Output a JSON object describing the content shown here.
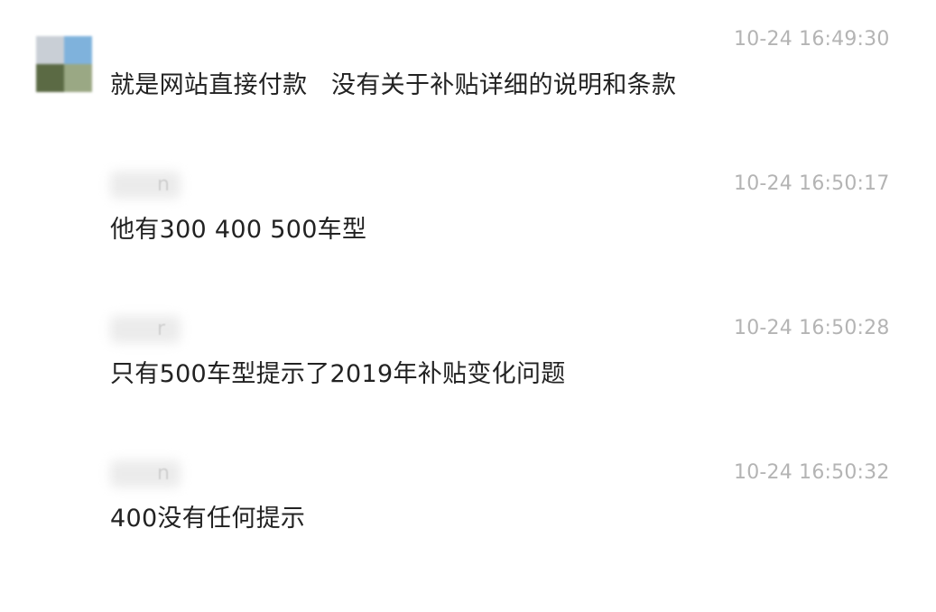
{
  "messages": [
    {
      "timestamp": "10-24 16:49:30",
      "text": "就是网站直接付款   没有关于补贴详细的说明和条款",
      "has_avatar": true,
      "sender_fragment": ""
    },
    {
      "timestamp": "10-24 16:50:17",
      "text": "他有300 400 500车型",
      "has_avatar": false,
      "sender_fragment": "n"
    },
    {
      "timestamp": "10-24 16:50:28",
      "text": "只有500车型提示了2019年补贴变化问题",
      "has_avatar": false,
      "sender_fragment": "r"
    },
    {
      "timestamp": "10-24 16:50:32",
      "text": "400没有任何提示",
      "has_avatar": false,
      "sender_fragment": "n"
    }
  ],
  "colors": {
    "timestamp": "#b4b4b4",
    "message_text": "#222222",
    "background": "#ffffff"
  }
}
